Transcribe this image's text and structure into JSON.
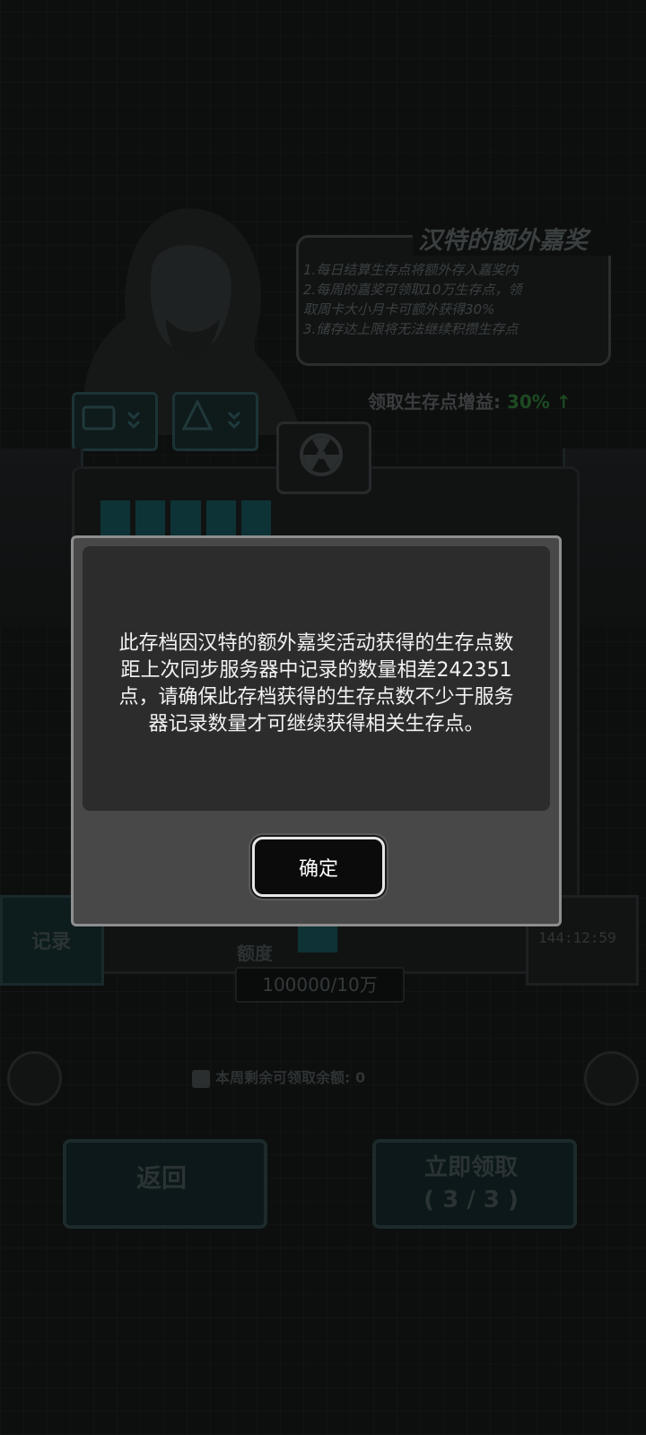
{
  "background": {
    "event_title": "汉特的额外嘉奖",
    "event_rules": [
      "1.每日结算生存点将额外存入嘉奖内",
      "2.每周的嘉奖可领取10万生存点，领",
      "取周卡大小月卡可额外获得30%",
      "3.储存达上限将无法继续积攒生存点"
    ],
    "bonus_label": "领取生存点增益:",
    "bonus_value": "30%",
    "bonus_arrow": "↑",
    "record_label": "记录",
    "timer": "144:12:59",
    "quota_label": "额度",
    "quota_value": "100000/10万",
    "remaining_text": "本周剩余可领取余额: 0",
    "back_label": "返回",
    "claim_label": "立即领取",
    "claim_count": "( 3 / 3 )"
  },
  "dialog": {
    "message": "此存档因汉特的额外嘉奖活动获得的生存点数\n距上次同步服务器中记录的数量相差242351\n点，请确保此存档获得的生存点数不少于服务\n器记录数量才可继续获得相关生存点。",
    "confirm_label": "确定"
  },
  "colors": {
    "overlay_bg": "#0b0c0c",
    "dialog_frame": "#484848",
    "dialog_panel": "#2c2c2c",
    "dialog_text": "#f2f2f2",
    "button_bg": "#0b0b0b"
  }
}
